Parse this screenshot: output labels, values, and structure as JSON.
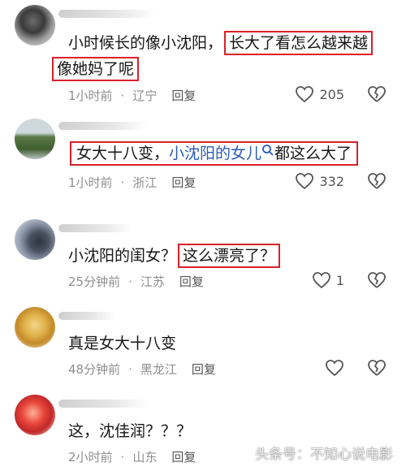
{
  "comments": [
    {
      "text_line1_pre": "小时候长的像小沈阳，",
      "highlight1": "长大了看怎么越来越",
      "highlight2": "像她妈了呢",
      "time": "1小时前",
      "sep": "·",
      "location": "辽宁",
      "reply_label": "回复",
      "likes": "205"
    },
    {
      "pre": "女大十八变，",
      "link": "小沈阳的女儿",
      "post": "都这么大了",
      "time": "1小时前",
      "sep": "·",
      "location": "浙江",
      "reply_label": "回复",
      "likes": "332"
    },
    {
      "pre": "小沈阳的闺女？",
      "highlight": "这么漂亮了？",
      "time": "25分钟前",
      "sep": "·",
      "location": "江苏",
      "reply_label": "回复",
      "likes": "1"
    },
    {
      "text": "真是女大十八变",
      "time": "48分钟前",
      "sep": "·",
      "location": "黑龙江",
      "reply_label": "回复"
    },
    {
      "text": "这，沈佳润？？？",
      "time": "2小时前",
      "sep": "·",
      "location": "山东",
      "reply_label": "回复"
    }
  ],
  "watermark": "头条号：不知心说电影",
  "icons": {
    "like": "heart-outline-icon",
    "dislike": "broken-heart-icon",
    "search": "search-icon"
  },
  "colors": {
    "highlight_box": "#d9202a",
    "link": "#2a5ab8"
  }
}
